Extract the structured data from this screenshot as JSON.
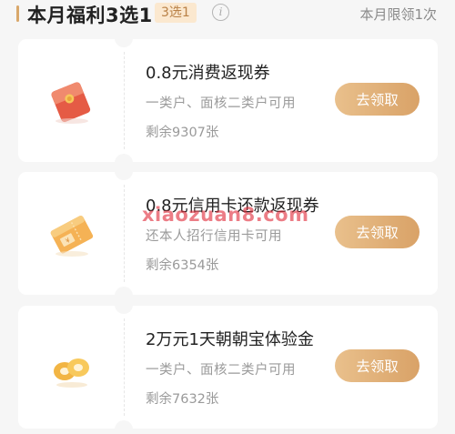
{
  "header": {
    "title": "本月福利3选1",
    "badge": "3选1",
    "info_icon": "i",
    "limit_text": "本月限领1次"
  },
  "coupons": [
    {
      "title": "0.8元消费返现券",
      "desc": "一类户、面核二类户可用",
      "remain": "剩余9307张",
      "button": "去领取",
      "icon": "red-envelope-icon"
    },
    {
      "title": "0.8元信用卡还款返现券",
      "desc": "还本人招行信用卡可用",
      "remain": "剩余6354张",
      "button": "去领取",
      "icon": "coupon-ticket-icon"
    },
    {
      "title": "2万元1天朝朝宝体验金",
      "desc": "一类户、面核二类户可用",
      "remain": "剩余7632张",
      "button": "去领取",
      "icon": "gold-coins-icon"
    }
  ],
  "watermark": "xiaozuan8.com",
  "colors": {
    "accent_gold": "#d9a267",
    "badge_bg": "#fbe8cf",
    "watermark_red": "#e02d3c"
  }
}
